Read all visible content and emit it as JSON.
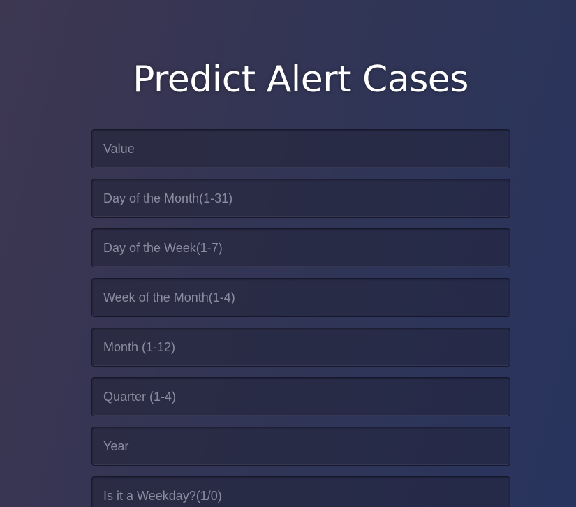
{
  "page": {
    "title": "Predict Alert Cases"
  },
  "form": {
    "fields": [
      {
        "placeholder": "Value"
      },
      {
        "placeholder": "Day of the Month(1-31)"
      },
      {
        "placeholder": "Day of the Week(1-7)"
      },
      {
        "placeholder": "Week of the Month(1-4)"
      },
      {
        "placeholder": "Month (1-12)"
      },
      {
        "placeholder": "Quarter (1-4)"
      },
      {
        "placeholder": "Year"
      },
      {
        "placeholder": "Is it a Weekday?(1/0)"
      }
    ]
  },
  "colors": {
    "background_start": "#3d3752",
    "background_end": "#28345e",
    "title": "#ffffff",
    "placeholder": "#8c8ba1"
  }
}
